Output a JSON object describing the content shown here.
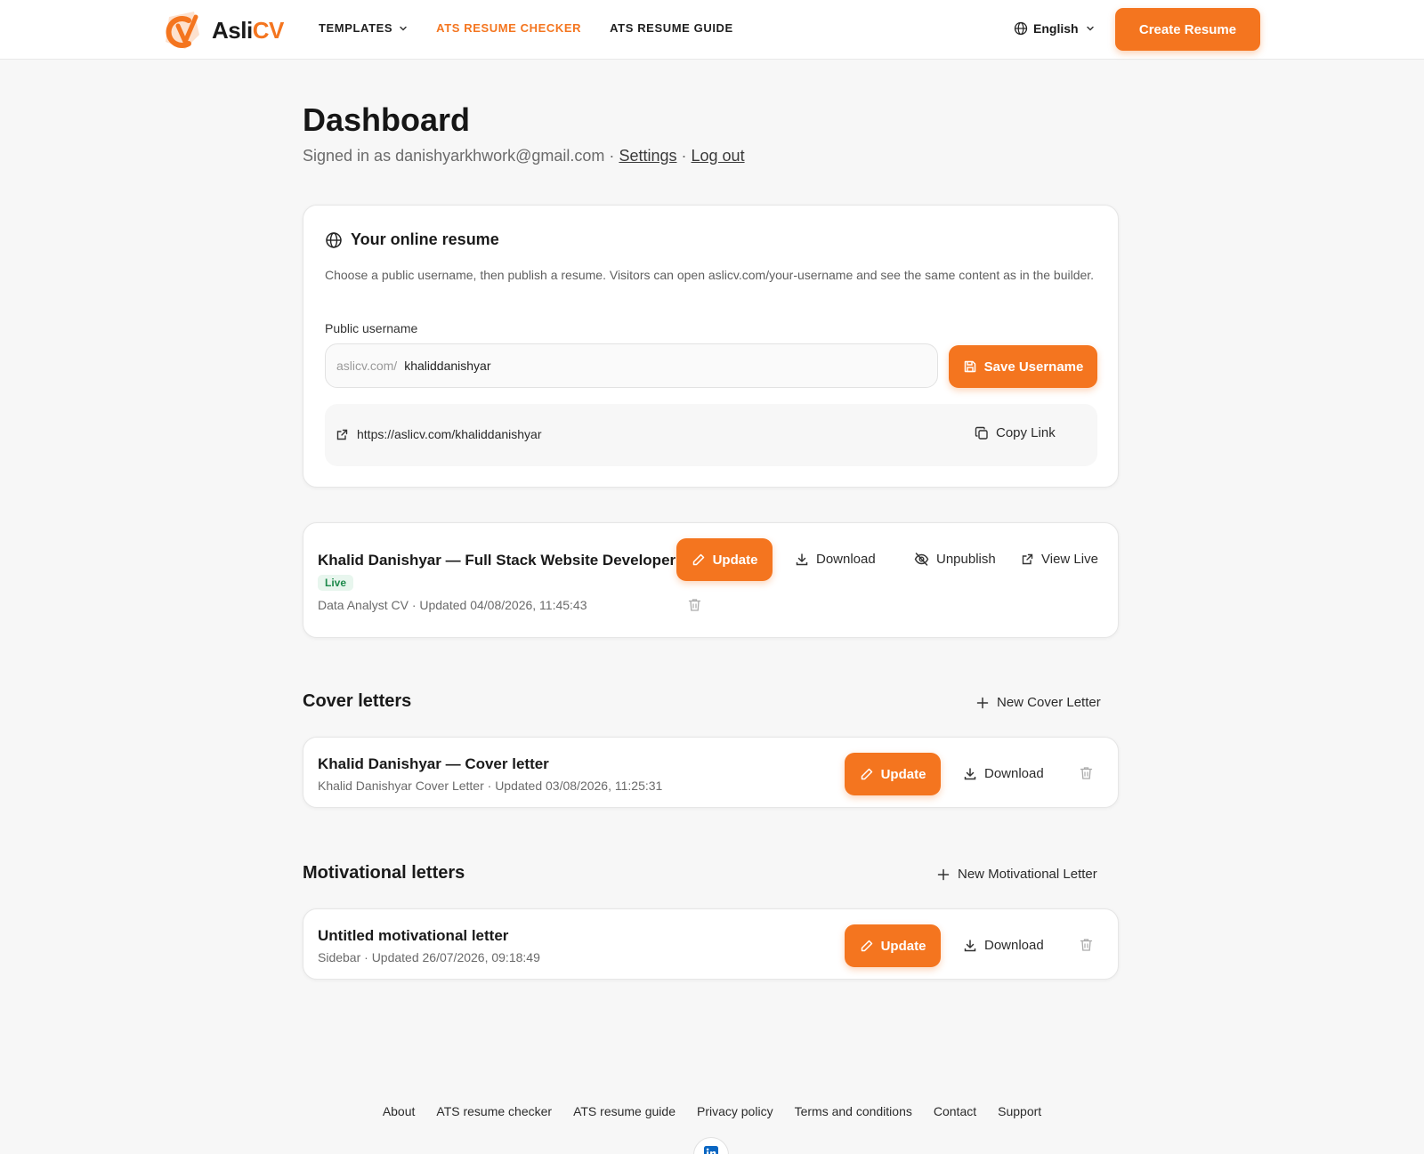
{
  "header": {
    "logo": {
      "part1": "Asli",
      "part2": "CV"
    },
    "nav": [
      {
        "label": "TEMPLATES"
      },
      {
        "label": "ATS RESUME CHECKER"
      },
      {
        "label": "ATS RESUME GUIDE"
      }
    ],
    "language": "English",
    "create_label": "Create Resume"
  },
  "colors": {
    "accent": "#f4751f",
    "live": "#1e8a4c"
  },
  "dashboard": {
    "title": "Dashboard",
    "signed_in_prefix": "Signed in as danishyarkhwork@gmail.com ·",
    "settings_label": "Settings",
    "separator": "·",
    "logout_label": "Log out"
  },
  "online_resume": {
    "title": "Your online resume",
    "description": "Choose a public username, then publish a resume. Visitors can open aslicv.com/your-username and see the same content as in the builder.",
    "username_label": "Public username",
    "prefix": "aslicv.com/",
    "username_value": "khaliddanishyar",
    "save_label": "Save Username",
    "public_url": "https://aslicv.com/khaliddanishyar",
    "copy_label": "Copy Link"
  },
  "resume": {
    "title": "Khalid Danishyar — Full Stack Website Developer",
    "status": "Live",
    "meta": "Data Analyst CV · Updated 04/08/2026, 11:45:43",
    "update_label": "Update",
    "download_label": "Download",
    "unpublish_label": "Unpublish",
    "view_live_label": "View Live"
  },
  "cover_letters": {
    "section_title": "Cover letters",
    "new_label": "New Cover Letter",
    "items": [
      {
        "title": "Khalid Danishyar — Cover letter",
        "meta": "Khalid Danishyar Cover Letter · Updated 03/08/2026, 11:25:31",
        "update_label": "Update",
        "download_label": "Download"
      }
    ]
  },
  "motivational_letters": {
    "section_title": "Motivational letters",
    "new_label": "New Motivational Letter",
    "items": [
      {
        "title": "Untitled motivational letter",
        "meta": "Sidebar · Updated 26/07/2026, 09:18:49",
        "update_label": "Update",
        "download_label": "Download"
      }
    ]
  },
  "footer": {
    "links": [
      "About",
      "ATS resume checker",
      "ATS resume guide",
      "Privacy policy",
      "Terms and conditions",
      "Contact",
      "Support"
    ],
    "social_icon": "linkedin-icon"
  }
}
